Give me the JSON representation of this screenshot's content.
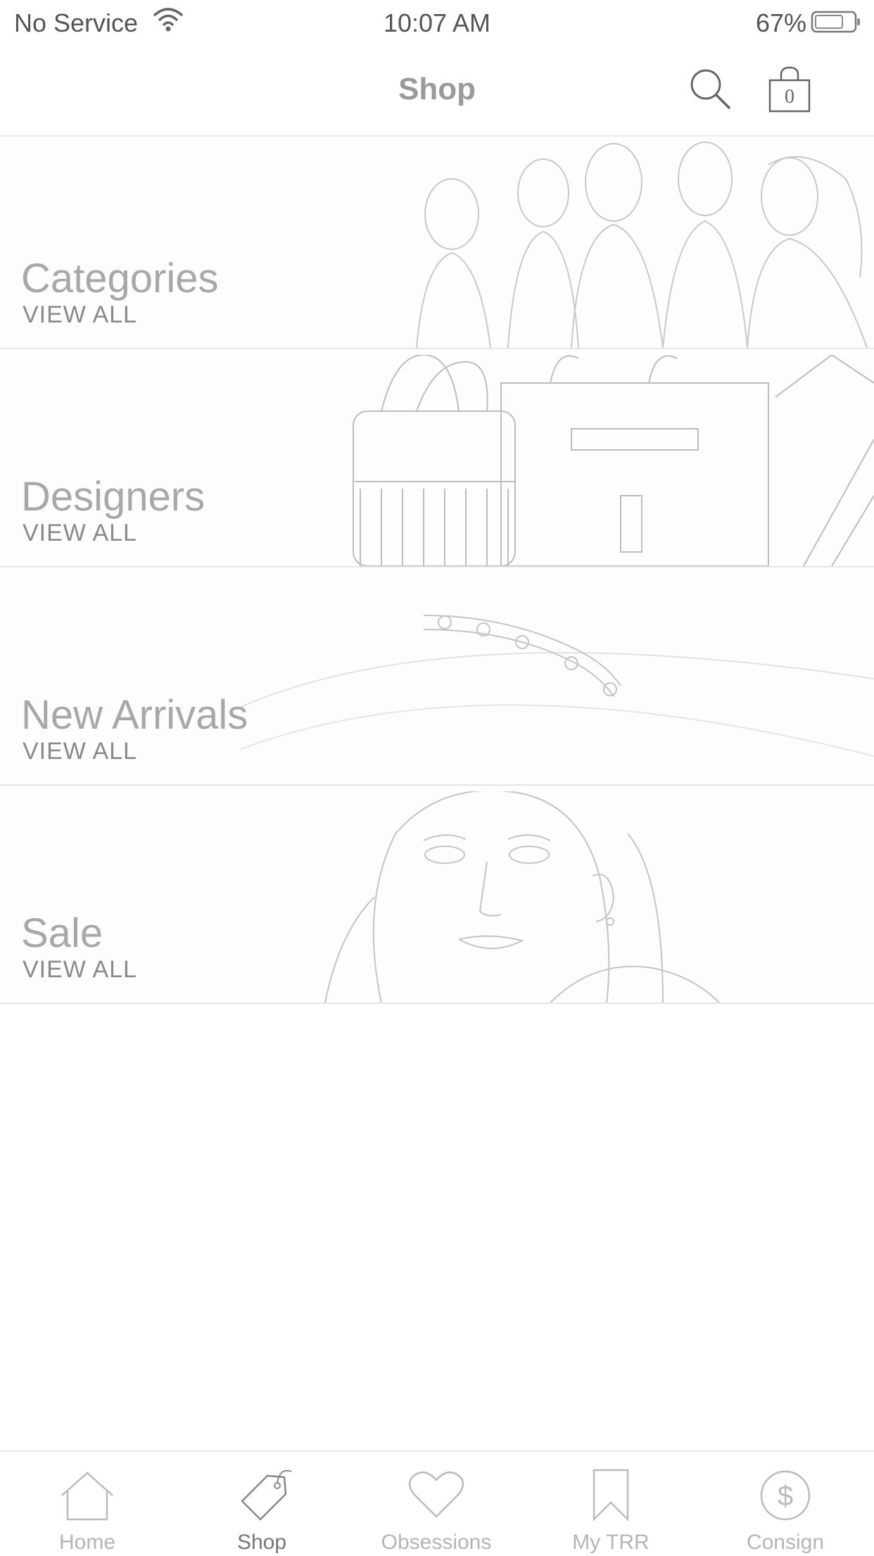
{
  "status_bar": {
    "carrier": "No Service",
    "time": "10:07 AM",
    "battery_pct": "67%"
  },
  "nav": {
    "title": "Shop",
    "bag_count": "0"
  },
  "sections": [
    {
      "title": "Categories",
      "link": "VIEW ALL"
    },
    {
      "title": "Designers",
      "link": "VIEW ALL"
    },
    {
      "title": "New Arrivals",
      "link": "VIEW ALL"
    },
    {
      "title": "Sale",
      "link": "VIEW ALL"
    }
  ],
  "tabs": [
    {
      "label": "Home",
      "icon": "home-icon",
      "active": false
    },
    {
      "label": "Shop",
      "icon": "tag-icon",
      "active": true
    },
    {
      "label": "Obsessions",
      "icon": "heart-icon",
      "active": false
    },
    {
      "label": "My TRR",
      "icon": "bookmark-icon",
      "active": false
    },
    {
      "label": "Consign",
      "icon": "dollar-circle-icon",
      "active": false
    }
  ]
}
